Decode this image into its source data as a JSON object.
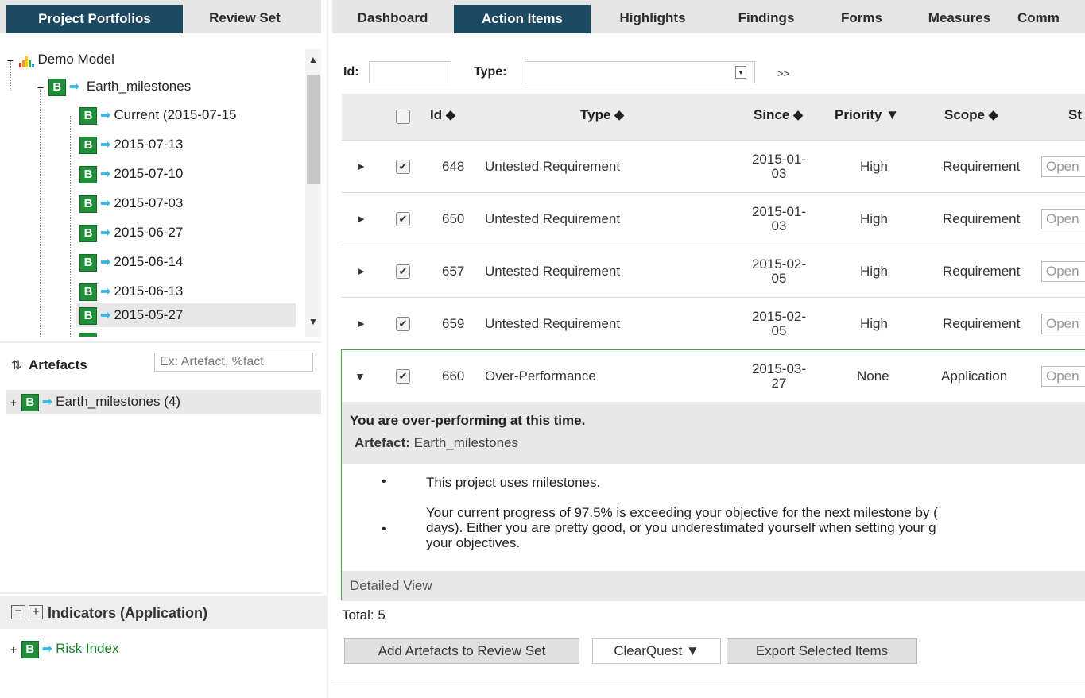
{
  "left_tabs": [
    "Project Portfolios",
    "Review Set"
  ],
  "main_tabs": [
    "Dashboard",
    "Action Items",
    "Highlights",
    "Findings",
    "Forms",
    "Measures",
    "Comm"
  ],
  "tree": {
    "root": "Demo Model",
    "project": "Earth_milestones",
    "versions": [
      "Current (2015-07-15",
      "2015-07-13",
      "2015-07-10",
      "2015-07-03",
      "2015-06-27",
      "2015-06-14",
      "2015-06-13",
      "2015-05-27"
    ]
  },
  "artefacts": {
    "title": "Artefacts",
    "filter_placeholder": "Ex: Artefact, %fact",
    "item": "Earth_milestones (4)"
  },
  "indicators": {
    "title": "Indicators (Application)",
    "item": "Risk Index"
  },
  "filters": {
    "id_label": "Id:",
    "type_label": "Type:",
    "more": ">>"
  },
  "columns": {
    "id": "Id ⬥",
    "type": "Type ⬥",
    "since": "Since ⬥",
    "priority": "Priority ▼",
    "scope": "Scope ⬥",
    "status": "St"
  },
  "rows": [
    {
      "id": "648",
      "type": "Untested Requirement",
      "since1": "2015-01-",
      "since2": "03",
      "priority": "High",
      "scope": "Requirement",
      "status": "Open"
    },
    {
      "id": "650",
      "type": "Untested Requirement",
      "since1": "2015-01-",
      "since2": "03",
      "priority": "High",
      "scope": "Requirement",
      "status": "Open"
    },
    {
      "id": "657",
      "type": "Untested Requirement",
      "since1": "2015-02-",
      "since2": "05",
      "priority": "High",
      "scope": "Requirement",
      "status": "Open"
    },
    {
      "id": "659",
      "type": "Untested Requirement",
      "since1": "2015-02-",
      "since2": "05",
      "priority": "High",
      "scope": "Requirement",
      "status": "Open"
    },
    {
      "id": "660",
      "type": "Over-Performance",
      "since1": "2015-03-",
      "since2": "27",
      "priority": "None",
      "scope": "Application",
      "status": "Open"
    }
  ],
  "detail": {
    "heading": "You are over-performing at this time.",
    "artefact_label": "Artefact:",
    "artefact_value": "Earth_milestones",
    "bullet1": "This project uses milestones.",
    "bullet2_line1": "Your current progress of 97.5% is exceeding your objective for the next milestone by (",
    "bullet2_line2": "days). Either you are pretty good, or you underestimated yourself when setting your g",
    "bullet2_line3": "your objectives.",
    "detailed_view": "Detailed View"
  },
  "total": "Total: 5",
  "buttons": {
    "add": "Add Artefacts to Review Set",
    "clearquest": "ClearQuest ▼",
    "export": "Export Selected Items"
  }
}
